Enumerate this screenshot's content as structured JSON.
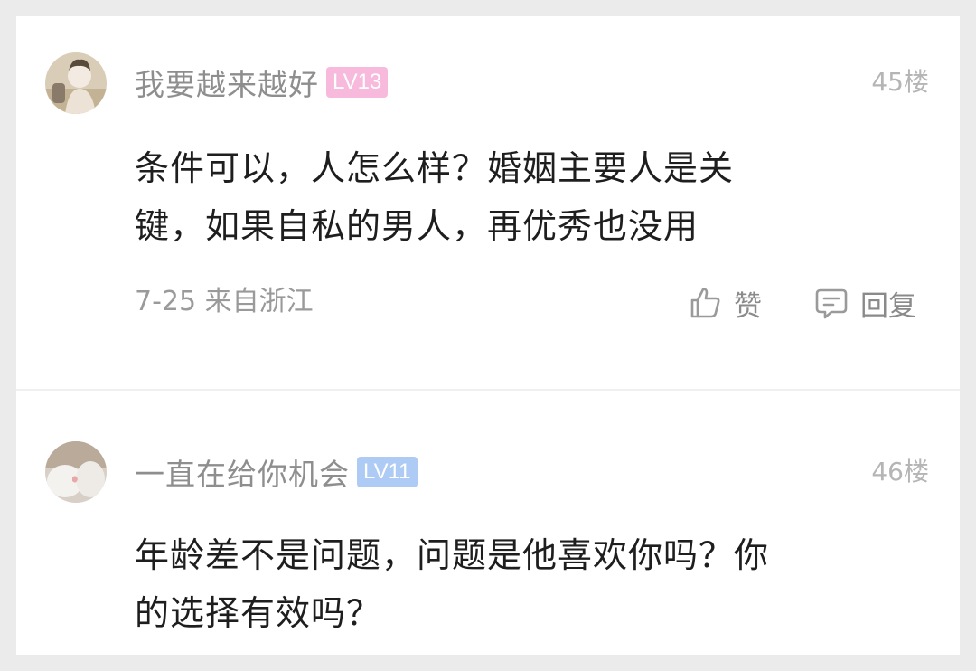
{
  "comments": [
    {
      "username": "我要越来越好",
      "level": "LV13",
      "floor": "45楼",
      "text_line1": "条件可以，人怎么样？婚姻主要人是关",
      "text_line2": "键，如果自私的男人，再优秀也没用",
      "date": "7-25",
      "location": "来自浙江",
      "like_label": "赞",
      "reply_label": "回复",
      "avatar_icon": "user-avatar-icon",
      "level_color": "#f7b9dc"
    },
    {
      "username": "一直在给你机会",
      "level": "LV11",
      "floor": "46楼",
      "text_line1": "年龄差不是问题，问题是他喜欢你吗？你",
      "text_line2": "的选择有效吗？",
      "avatar_icon": "user-avatar-icon",
      "level_color": "#aecbf5"
    }
  ]
}
